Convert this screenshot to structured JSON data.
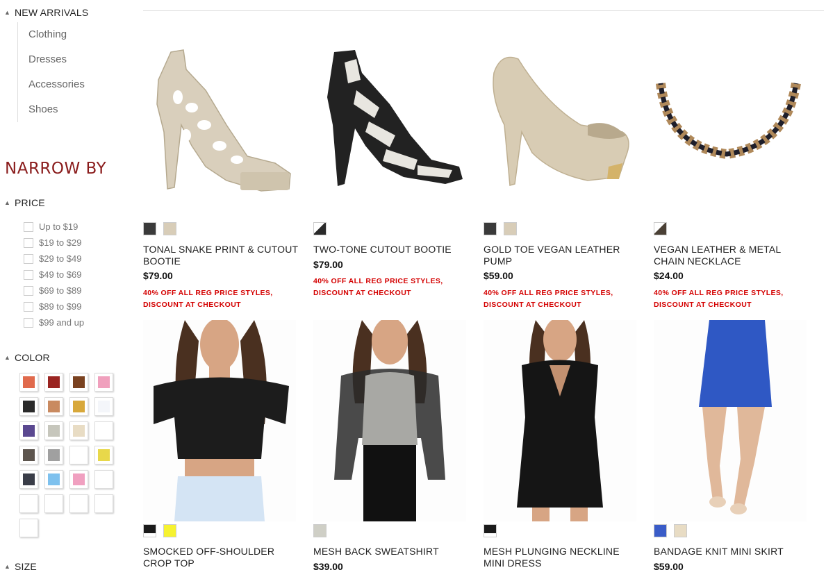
{
  "sidebar": {
    "section_new_arrivals": "NEW ARRIVALS",
    "categories": [
      "Clothing",
      "Dresses",
      "Accessories",
      "Shoes"
    ],
    "narrow_by": "NARROW BY",
    "price_heading": "PRICE",
    "price_options": [
      "Up to $19",
      "$19 to $29",
      "$29 to $49",
      "$49 to $69",
      "$69 to $89",
      "$89 to $99",
      "$99 and up"
    ],
    "color_heading": "COLOR",
    "colors": [
      "#e06a4c",
      "#9a2421",
      "#7a4220",
      "#f0a0bd",
      "#2a2a2a",
      "#c98a60",
      "#d8a83a",
      "#f4f6fa",
      "#5a4890",
      "#c6c6bc",
      "#e8dcc4",
      "#ffffff",
      "#5d554e",
      "#a0a0a0",
      "#ffffff",
      "#e8d84a",
      "#3a3d48",
      "#7ec1ee",
      "#f0a0c0",
      "#ffffff",
      "#ffffff",
      "#ffffff",
      "#ffffff",
      "#ffffff",
      "#ffffff"
    ],
    "size_heading": "SIZE"
  },
  "products": [
    {
      "name": "TONAL SNAKE PRINT & CUTOUT BOOTIE",
      "price": "$79.00",
      "promo": "40% OFF ALL REG PRICE STYLES, DISCOUNT AT CHECKOUT",
      "swatches": [
        "#3a3a3a",
        "#d8cdb8"
      ],
      "image": "cream-cutout-heel"
    },
    {
      "name": "TWO-TONE CUTOUT BOOTIE",
      "price": "$79.00",
      "promo": "40% OFF ALL REG PRICE STYLES, DISCOUNT AT CHECKOUT",
      "swatches": [
        "#2a2a2a"
      ],
      "image": "black-white-cutout-heel"
    },
    {
      "name": "GOLD TOE VEGAN LEATHER PUMP",
      "price": "$59.00",
      "promo": "40% OFF ALL REG PRICE STYLES, DISCOUNT AT CHECKOUT",
      "swatches": [
        "#3a3a3a",
        "#d8cdb8"
      ],
      "image": "nude-platform-pump"
    },
    {
      "name": "VEGAN LEATHER & METAL CHAIN NECKLACE",
      "price": "$24.00",
      "promo": "40% OFF ALL REG PRICE STYLES, DISCOUNT AT CHECKOUT",
      "swatches": [
        "#4a4035"
      ],
      "image": "chain-necklace"
    },
    {
      "name": "SMOCKED OFF-SHOULDER CROP TOP",
      "swatches": [
        "#1a1a1a",
        "#f6f230"
      ],
      "image": "model-black-crop-top"
    },
    {
      "name": "MESH BACK SWEATSHIRT",
      "price": "$39.00",
      "swatches": [
        "#cfcfc6"
      ],
      "image": "model-grey-sweatshirt"
    },
    {
      "name": "MESH PLUNGING NECKLINE MINI DRESS",
      "swatches": [
        "#1a1a1a"
      ],
      "image": "model-black-dress"
    },
    {
      "name": "BANDAGE KNIT MINI SKIRT",
      "price": "$59.00",
      "swatches": [
        "#3a5cc8",
        "#e8dcc4"
      ],
      "image": "model-blue-skirt"
    }
  ]
}
